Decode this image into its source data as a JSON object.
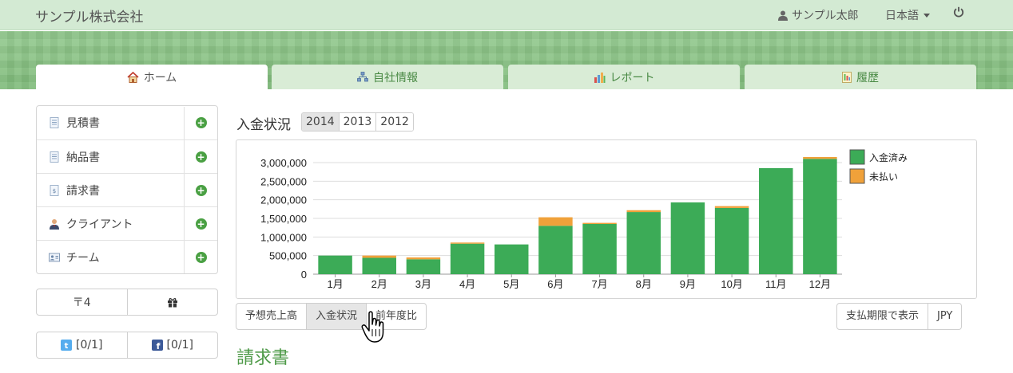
{
  "header": {
    "brand": "サンプル株式会社",
    "user_name": "サンプル太郎",
    "language": "日本語"
  },
  "tabs": [
    {
      "label": "ホーム",
      "icon": "home-icon",
      "active": true
    },
    {
      "label": "自社情報",
      "icon": "org-chart-icon",
      "active": false
    },
    {
      "label": "レポート",
      "icon": "bar-chart-icon",
      "active": false
    },
    {
      "label": "履歴",
      "icon": "history-icon",
      "active": false
    }
  ],
  "sidebar": {
    "items": [
      {
        "label": "見積書",
        "icon": "document-icon"
      },
      {
        "label": "納品書",
        "icon": "document-icon"
      },
      {
        "label": "請求書",
        "icon": "invoice-icon"
      },
      {
        "label": "クライアント",
        "icon": "person-icon"
      },
      {
        "label": "チーム",
        "icon": "id-card-icon"
      }
    ],
    "postal_label": "〒4",
    "twitter_label": "[0/1]",
    "facebook_label": "[0/1]"
  },
  "main": {
    "section_title": "入金状況",
    "years": [
      "2014",
      "2013",
      "2012"
    ],
    "selected_year": "2014",
    "view_buttons": [
      "予想売上高",
      "入金状況",
      "前年度比"
    ],
    "selected_view": "入金状況",
    "due_date_button": "支払期限で表示",
    "currency_button": "JPY",
    "next_heading": "請求書"
  },
  "colors": {
    "paid": "#3cab57",
    "unpaid": "#f0a13a",
    "accent_green": "#4e9a48"
  },
  "chart_data": {
    "type": "bar",
    "stacked": true,
    "categories": [
      "1月",
      "2月",
      "3月",
      "4月",
      "5月",
      "6月",
      "7月",
      "8月",
      "9月",
      "10月",
      "11月",
      "12月"
    ],
    "series": [
      {
        "name": "入金済み",
        "values": [
          500000,
          440000,
          400000,
          820000,
          800000,
          1300000,
          1350000,
          1670000,
          1930000,
          1780000,
          2850000,
          3100000
        ]
      },
      {
        "name": "未払い",
        "values": [
          0,
          60000,
          50000,
          30000,
          0,
          230000,
          30000,
          50000,
          0,
          50000,
          0,
          50000
        ]
      }
    ],
    "ylim": [
      0,
      3000000
    ],
    "yticks": [
      0,
      500000,
      1000000,
      1500000,
      2000000,
      2500000,
      3000000
    ],
    "ytick_labels": [
      "0",
      "500,000",
      "1,000,000",
      "1,500,000",
      "2,000,000",
      "2,500,000",
      "3,000,000"
    ],
    "grid": true,
    "legend": "top-right",
    "title": "",
    "xlabel": "",
    "ylabel": ""
  }
}
